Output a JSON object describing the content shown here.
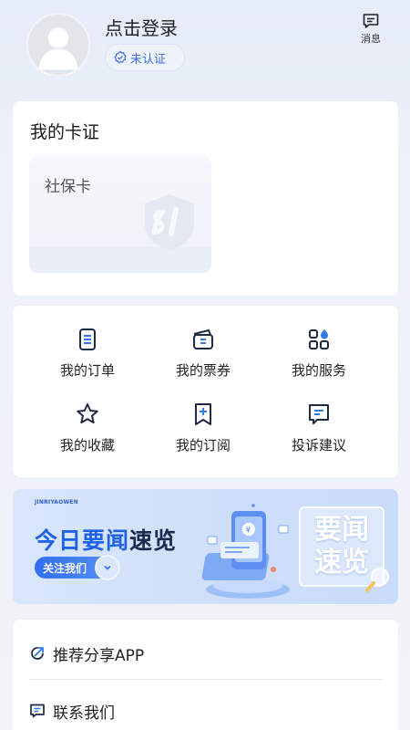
{
  "header": {
    "login_text": "点击登录",
    "verify_badge": "未认证",
    "message_label": "消息"
  },
  "cards": {
    "title": "我的卡证",
    "social_card": {
      "name": "社保卡"
    }
  },
  "services": [
    {
      "label": "我的订单",
      "icon": "order-icon"
    },
    {
      "label": "我的票券",
      "icon": "ticket-icon"
    },
    {
      "label": "我的服务",
      "icon": "services-icon"
    },
    {
      "label": "我的收藏",
      "icon": "star-icon"
    },
    {
      "label": "我的订阅",
      "icon": "bookmark-add-icon"
    },
    {
      "label": "投诉建议",
      "icon": "feedback-icon"
    }
  ],
  "banner": {
    "brand": "JINRIYAOWEN",
    "headline_part1": "今日要闻",
    "headline_part2": "速览",
    "follow_label": "关注我们",
    "side_line1": "要闻",
    "side_line2": "速览"
  },
  "list": [
    {
      "label": "推荐分享APP",
      "icon": "share-icon"
    },
    {
      "label": "联系我们",
      "icon": "contact-icon"
    }
  ],
  "colors": {
    "accent": "#3d6fd9",
    "icon_blue": "#2f7be8",
    "icon_dark": "#1f2a44"
  }
}
